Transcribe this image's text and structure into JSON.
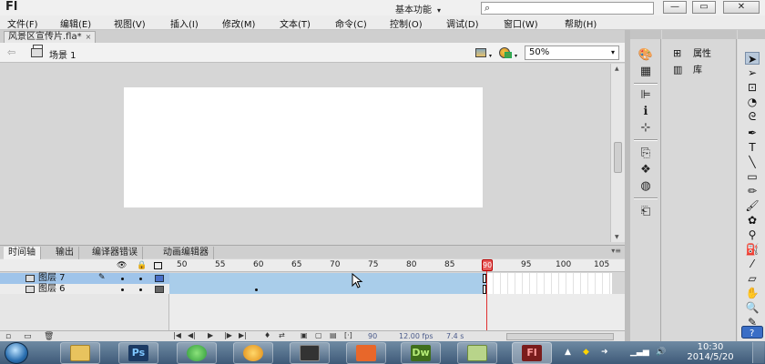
{
  "app": {
    "logo": "Fl"
  },
  "titlebar": {
    "workspace_label": "基本功能",
    "search_placeholder": "",
    "minimize": "—",
    "maximize": "▭",
    "close": "✕"
  },
  "menu": [
    "文件(F)",
    "编辑(E)",
    "视图(V)",
    "插入(I)",
    "修改(M)",
    "文本(T)",
    "命令(C)",
    "控制(O)",
    "调试(D)",
    "窗口(W)",
    "帮助(H)"
  ],
  "document": {
    "tab_label": "风景区宣传片.fla*",
    "close": "×"
  },
  "editbar": {
    "back": "⇦",
    "scene_label": "场景 1",
    "zoom": "50%"
  },
  "timeline": {
    "tabs": [
      "时间轴",
      "输出",
      "编译器错误",
      "动画编辑器"
    ],
    "ruler_ticks": [
      "50",
      "55",
      "60",
      "65",
      "70",
      "75",
      "80",
      "85",
      "90",
      "95",
      "100",
      "105"
    ],
    "playhead_frame": "90",
    "layers": [
      {
        "name": "图层 7",
        "selected": true
      },
      {
        "name": "图层 6",
        "selected": false
      }
    ],
    "footer": {
      "frame": "90",
      "fps": "12.00 fps",
      "time": "7.4 s"
    }
  },
  "dock2": [
    {
      "icon": "properties-icon",
      "label": "属性"
    },
    {
      "icon": "library-icon",
      "label": "库"
    }
  ],
  "taskbar": {
    "apps": [
      {
        "name": "explorer",
        "label": ""
      },
      {
        "name": "photoshop",
        "label": "Ps"
      },
      {
        "name": "browser",
        "label": ""
      },
      {
        "name": "qq",
        "label": ""
      },
      {
        "name": "video",
        "label": ""
      },
      {
        "name": "ppt",
        "label": ""
      },
      {
        "name": "dreamweaver",
        "label": "Dw"
      },
      {
        "name": "notes",
        "label": ""
      },
      {
        "name": "flash",
        "label": "Fl"
      }
    ],
    "clock_time": "10:30",
    "clock_date": "2014/5/20"
  },
  "colors": {
    "playhead": "#e03030",
    "layer_selected": "#9fc4ea",
    "ps": "#1b3a63",
    "dw": "#3f6e1b",
    "fl": "#7a1c1c"
  }
}
